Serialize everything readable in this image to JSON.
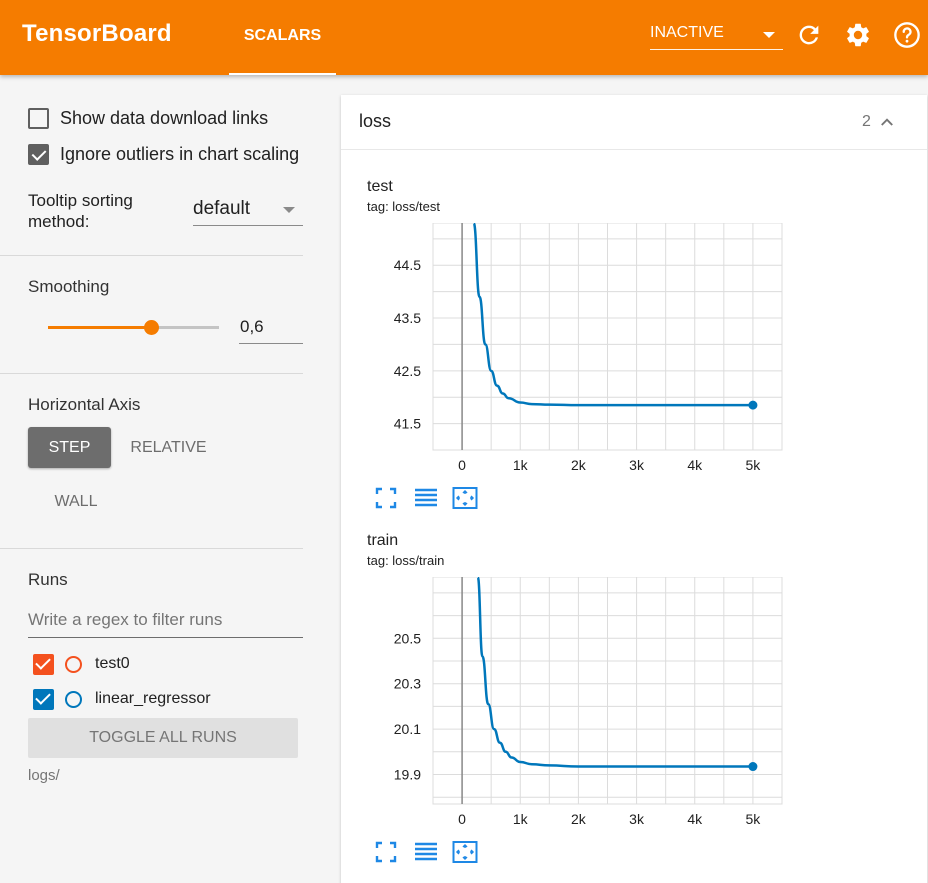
{
  "header": {
    "brand": "TensorBoard",
    "tab_label": "SCALARS",
    "status_select": "INACTIVE",
    "icons": [
      "refresh-icon",
      "settings-icon",
      "help-icon"
    ]
  },
  "sidebar": {
    "show_download_links": {
      "label": "Show data download links",
      "checked": false
    },
    "ignore_outliers": {
      "label": "Ignore outliers in chart scaling",
      "checked": true
    },
    "tooltip_sorting": {
      "label": "Tooltip sorting method:",
      "value": "default"
    },
    "smoothing": {
      "title": "Smoothing",
      "value": "0,6",
      "fraction": 0.6
    },
    "horizontal_axis": {
      "title": "Horizontal Axis",
      "options": [
        "STEP",
        "RELATIVE",
        "WALL"
      ],
      "selected": "STEP"
    },
    "runs": {
      "title": "Runs",
      "filter_placeholder": "Write a regex to filter runs",
      "items": [
        {
          "name": "test0",
          "color": "#f4511e",
          "checked": true
        },
        {
          "name": "linear_regressor",
          "color": "#0077bb",
          "checked": true
        }
      ],
      "toggle_all_label": "TOGGLE ALL RUNS",
      "logdir": "logs/"
    }
  },
  "main": {
    "card": {
      "title": "loss",
      "count": "2"
    }
  },
  "colors": {
    "accent": "#f57c00",
    "series": "#0077bb"
  },
  "chart_data": [
    {
      "type": "line",
      "title": "test",
      "tag": "tag: loss/test",
      "xticks": [
        "0",
        "1k",
        "2k",
        "3k",
        "4k",
        "5k"
      ],
      "yticks": [
        "44.5",
        "43.5",
        "42.5",
        "41.5"
      ],
      "xlim": [
        -500,
        5500
      ],
      "ylim": [
        41.0,
        45.3
      ],
      "series": [
        {
          "x": [
            200,
            300,
            400,
            500,
            600,
            700,
            800,
            1000,
            1200,
            1500,
            2000,
            3000,
            4000,
            5000
          ],
          "y": [
            45.3,
            43.9,
            43.0,
            42.5,
            42.22,
            42.07,
            41.98,
            41.9,
            41.87,
            41.86,
            41.85,
            41.85,
            41.85,
            41.85
          ]
        }
      ]
    },
    {
      "type": "line",
      "title": "train",
      "tag": "tag: loss/train",
      "xticks": [
        "0",
        "1k",
        "2k",
        "3k",
        "4k",
        "5k"
      ],
      "yticks": [
        "20.5",
        "20.3",
        "20.1",
        "19.9"
      ],
      "xlim": [
        -500,
        5500
      ],
      "ylim": [
        19.77,
        20.77
      ],
      "series": [
        {
          "x": [
            270,
            350,
            450,
            550,
            650,
            750,
            850,
            1000,
            1200,
            1500,
            2000,
            3000,
            4000,
            5000
          ],
          "y": [
            20.77,
            20.42,
            20.21,
            20.1,
            20.04,
            20.0,
            19.975,
            19.955,
            19.945,
            19.94,
            19.935,
            19.935,
            19.935,
            19.935
          ]
        }
      ]
    }
  ]
}
